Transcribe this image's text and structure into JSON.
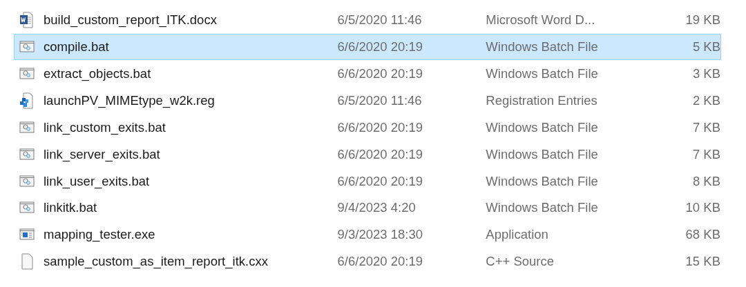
{
  "files": [
    {
      "name": "build_custom_report_ITK.docx",
      "kind": "word",
      "modified": "6/5/2020 11:46",
      "type": "Microsoft Word D...",
      "size": "19 KB",
      "selected": false
    },
    {
      "name": "compile.bat",
      "kind": "batch",
      "modified": "6/6/2020 20:19",
      "type": "Windows Batch File",
      "size": "5 KB",
      "selected": true
    },
    {
      "name": "extract_objects.bat",
      "kind": "batch",
      "modified": "6/6/2020 20:19",
      "type": "Windows Batch File",
      "size": "3 KB",
      "selected": false
    },
    {
      "name": "launchPV_MIMEtype_w2k.reg",
      "kind": "registry",
      "modified": "6/5/2020 11:46",
      "type": "Registration Entries",
      "size": "2 KB",
      "selected": false
    },
    {
      "name": "link_custom_exits.bat",
      "kind": "batch",
      "modified": "6/6/2020 20:19",
      "type": "Windows Batch File",
      "size": "7 KB",
      "selected": false
    },
    {
      "name": "link_server_exits.bat",
      "kind": "batch",
      "modified": "6/6/2020 20:19",
      "type": "Windows Batch File",
      "size": "7 KB",
      "selected": false
    },
    {
      "name": "link_user_exits.bat",
      "kind": "batch",
      "modified": "6/6/2020 20:19",
      "type": "Windows Batch File",
      "size": "8 KB",
      "selected": false
    },
    {
      "name": "linkitk.bat",
      "kind": "batch",
      "modified": "9/4/2023 4:20",
      "type": "Windows Batch File",
      "size": "10 KB",
      "selected": false
    },
    {
      "name": "mapping_tester.exe",
      "kind": "exe",
      "modified": "9/3/2023 18:30",
      "type": "Application",
      "size": "68 KB",
      "selected": false
    },
    {
      "name": "sample_custom_as_item_report_itk.cxx",
      "kind": "blank",
      "modified": "6/6/2020 20:19",
      "type": "C++ Source",
      "size": "15 KB",
      "selected": false
    }
  ]
}
